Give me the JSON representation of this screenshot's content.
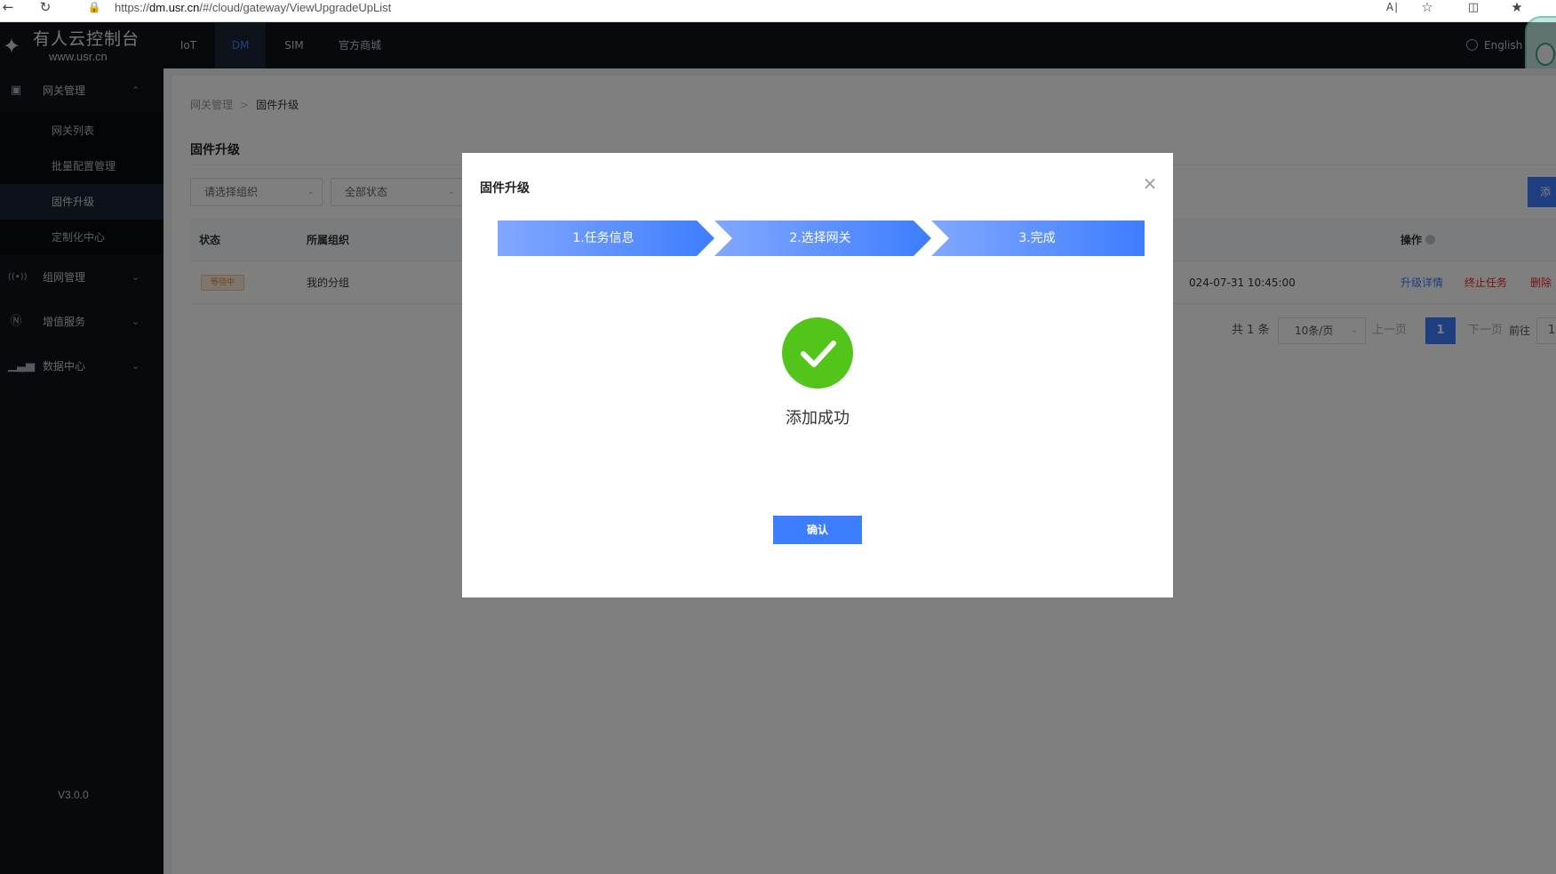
{
  "browser": {
    "url_prefix": "https://",
    "url_host": "dm.usr.cn",
    "url_path": "/#/cloud/gateway/ViewUpgradeUpList"
  },
  "topnav": {
    "logo_title": "有人云控制台",
    "logo_sub": "www.usr.cn",
    "items": [
      "IoT",
      "DM",
      "SIM",
      "官方商城"
    ],
    "active_item": "DM",
    "language": "English"
  },
  "sidebar": {
    "groups": [
      {
        "label": "网关管理",
        "icon": "gateway-icon",
        "expanded": true
      },
      {
        "label": "组网管理",
        "icon": "network-icon",
        "expanded": false
      },
      {
        "label": "增值服务",
        "icon": "yen-icon",
        "expanded": false
      },
      {
        "label": "数据中心",
        "icon": "bar-chart-icon",
        "expanded": false
      }
    ],
    "sub_items": [
      "网关列表",
      "批量配置管理",
      "固件升级",
      "定制化中心"
    ],
    "active_sub": "固件升级",
    "version": "V3.0.0"
  },
  "page": {
    "breadcrumb": [
      "网关管理",
      "固件升级"
    ],
    "title": "固件升级",
    "filters": {
      "org_placeholder": "请选择组织",
      "status_value": "全部状态"
    },
    "add_button": "添",
    "table": {
      "headers": [
        "状态",
        "所属组织",
        "操作"
      ],
      "rows": [
        {
          "status": "等待中",
          "org": "我的分组",
          "time": "024-07-31 10:45:00",
          "actions": [
            "升级详情",
            "终止任务",
            "删除"
          ]
        }
      ]
    },
    "pagination": {
      "total": "共 1 条",
      "page_size": "10条/页",
      "prev": "上一页",
      "current": "1",
      "next": "下一页",
      "goto_label": "前往",
      "goto_value": "1"
    }
  },
  "modal": {
    "title": "固件升级",
    "steps": [
      "1.任务信息",
      "2.选择网关",
      "3.完成"
    ],
    "success_text": "添加成功",
    "confirm_label": "确认"
  },
  "colors": {
    "primary": "#3d7dff",
    "step_light": "#6f9bff",
    "success": "#52c41a",
    "danger": "#f5222d",
    "nav_bg": "#0e1219"
  }
}
